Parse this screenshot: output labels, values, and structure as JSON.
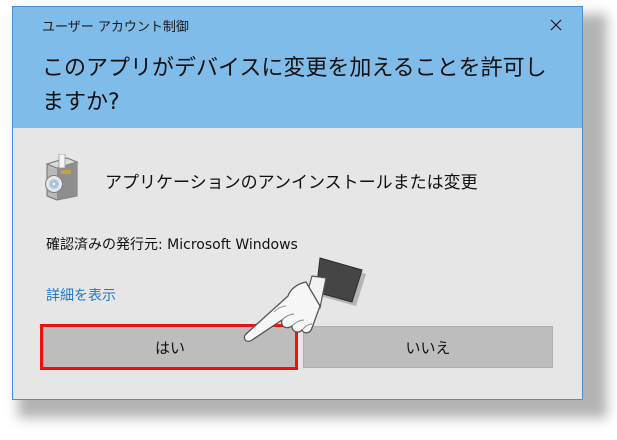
{
  "window": {
    "title": "ユーザー アカウント制御",
    "close_icon": "close-icon"
  },
  "prompt": {
    "question": "このアプリがデバイスに変更を加えることを許可しますか?"
  },
  "app": {
    "icon": "installer-disc-box-icon",
    "name": "アプリケーションのアンインストールまたは変更"
  },
  "publisher": {
    "text": "確認済みの発行元: Microsoft Windows"
  },
  "details": {
    "link_label": "詳細を表示"
  },
  "buttons": {
    "yes_label": "はい",
    "no_label": "いいえ"
  },
  "annotation": {
    "highlight_color": "#ee1111",
    "pointer": "pointing-hand-icon"
  },
  "colors": {
    "header": "#7fbcea",
    "body": "#e6e6e6",
    "button": "#bdbdbd",
    "link": "#1f78c8"
  }
}
